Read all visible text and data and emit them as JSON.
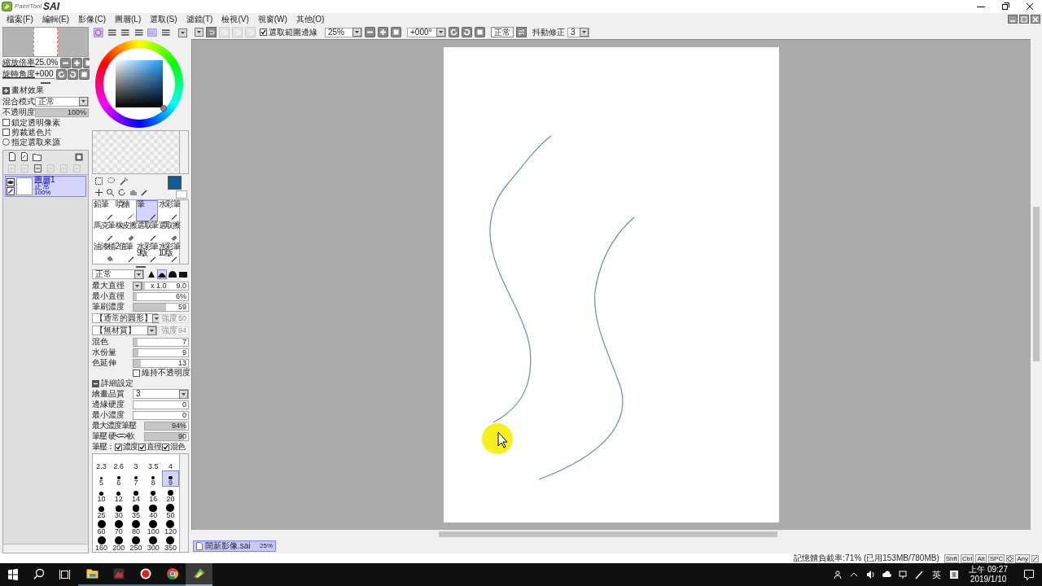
{
  "app": {
    "logo_small": "PaintTool",
    "logo_big": "SAI"
  },
  "menu": [
    "檔案(F)",
    "編輯(E)",
    "影像(C)",
    "圖層(L)",
    "選取(S)",
    "濾鏡(T)",
    "檢視(V)",
    "視窗(W)",
    "其他(O)"
  ],
  "toolbar": {
    "selection_edge": {
      "label": "選取範圍邊緣",
      "checked": true
    },
    "zoom": "25%",
    "rotation": "+000°",
    "blend": "正常",
    "stabilizer": {
      "label": "抖動修正",
      "value": "3"
    }
  },
  "navigator": {
    "zoom": {
      "label": "縮放倍率",
      "value": "25.0%"
    },
    "rotation": {
      "label": "旋轉角度",
      "value": "+000"
    }
  },
  "layer_panel": {
    "texture_toggle": {
      "label": "畫材效果",
      "expanded": false
    },
    "blend": {
      "label": "混合模式",
      "value": "正常"
    },
    "opacity": {
      "label": "不透明度",
      "value": "100%",
      "level": 1
    },
    "options": [
      {
        "kind": "checkbox",
        "label": "鎖定透明像素",
        "checked": false
      },
      {
        "kind": "checkbox",
        "label": "剪裁遮色片",
        "checked": false
      },
      {
        "kind": "radio",
        "label": "指定選取來源",
        "checked": false
      }
    ],
    "layers": [
      {
        "name": "圖層1",
        "mode": "正常",
        "opacity": "100%",
        "selected": true
      }
    ]
  },
  "tools": [
    {
      "label": "鉛筆",
      "kind": "pen",
      "selected": false
    },
    {
      "label": "噴槍",
      "kind": "airbrush",
      "selected": false
    },
    {
      "label": "筆",
      "kind": "pen",
      "selected": true
    },
    {
      "label": "水彩筆",
      "kind": "pen",
      "selected": false
    },
    {
      "label": "馬克筆",
      "kind": "pen",
      "selected": false
    },
    {
      "label": "橡皮擦",
      "kind": "eraser",
      "selected": false
    },
    {
      "label": "選取筆",
      "kind": "pen",
      "selected": false
    },
    {
      "label": "選取擦",
      "kind": "eraser",
      "selected": false
    },
    {
      "label": "油漆桶",
      "kind": "bucket",
      "selected": false
    },
    {
      "label": "2值筆",
      "kind": "pen",
      "selected": false
    },
    {
      "label": "水彩筆 9版",
      "kind": "pen",
      "selected": false
    },
    {
      "label": "水彩筆 10版",
      "kind": "pen",
      "selected": false
    }
  ],
  "brush": {
    "mode": "正常",
    "shapes": [
      {
        "selected": false
      },
      {
        "selected": true
      },
      {
        "selected": false
      },
      {
        "selected": false
      }
    ],
    "sliders": [
      {
        "label": "最大直徑",
        "prefix": "x 1.0",
        "value": "9.0",
        "level": 0.05
      },
      {
        "label": "最小直徑",
        "value": "6%",
        "level": 0.06
      },
      {
        "label": "筆刷濃度",
        "value": "59",
        "level": 0.59
      }
    ],
    "textures": [
      {
        "label": "【通常的圓形】",
        "strength_label": "強度",
        "strength": "50",
        "disabled": true
      },
      {
        "label": "【無材質】",
        "strength_label": "強度",
        "strength": "94",
        "disabled": true
      }
    ],
    "mix_sliders": [
      {
        "label": "混色",
        "value": "7",
        "level": 0.07
      },
      {
        "label": "水份量",
        "value": "9",
        "level": 0.09
      },
      {
        "label": "色延伸",
        "value": "13",
        "level": 0.13
      }
    ],
    "keep_opacity": {
      "label": "維持不透明度",
      "checked": false
    }
  },
  "advanced": {
    "title": "詳細設定",
    "expanded": true,
    "quality": {
      "label": "繪畫品質",
      "value": "3"
    },
    "sliders": [
      {
        "label": "邊緣硬度",
        "value": "0",
        "level": 0
      },
      {
        "label": "最小濃度",
        "value": "0",
        "level": 0
      },
      {
        "label": "最大濃度筆壓",
        "value": "94%",
        "level": 0.94
      },
      {
        "label": "筆壓 硬<=>軟",
        "value": "90",
        "level": 0.9
      }
    ],
    "pressure": {
      "label": "筆壓：",
      "options": [
        {
          "label": "濃度",
          "checked": true
        },
        {
          "label": "直徑",
          "checked": true
        },
        {
          "label": "混色",
          "checked": true
        }
      ]
    }
  },
  "brush_sizes": [
    {
      "label": "2.3",
      "selected": false
    },
    {
      "label": "2.6",
      "selected": false
    },
    {
      "label": "3",
      "selected": false
    },
    {
      "label": "3.5",
      "selected": false
    },
    {
      "label": "4",
      "selected": false
    },
    {
      "label": "5",
      "selected": false
    },
    {
      "label": "6",
      "selected": false
    },
    {
      "label": "7",
      "selected": false
    },
    {
      "label": "8",
      "selected": false
    },
    {
      "label": "9",
      "selected": true
    },
    {
      "label": "10",
      "selected": false
    },
    {
      "label": "12",
      "selected": false
    },
    {
      "label": "14",
      "selected": false
    },
    {
      "label": "16",
      "selected": false
    },
    {
      "label": "20",
      "selected": false
    },
    {
      "label": "25",
      "selected": false
    },
    {
      "label": "30",
      "selected": false
    },
    {
      "label": "35",
      "selected": false
    },
    {
      "label": "40",
      "selected": false
    },
    {
      "label": "50",
      "selected": false
    },
    {
      "label": "60",
      "selected": false
    },
    {
      "label": "70",
      "selected": false
    },
    {
      "label": "80",
      "selected": false
    },
    {
      "label": "100",
      "selected": false
    },
    {
      "label": "120",
      "selected": false
    },
    {
      "label": "160",
      "selected": false
    },
    {
      "label": "200",
      "selected": false
    },
    {
      "label": "250",
      "selected": false
    },
    {
      "label": "300",
      "selected": false
    },
    {
      "label": "350",
      "selected": false
    }
  ],
  "document_tabs": [
    {
      "name": "開新影像.sai",
      "zoom": "25%",
      "selected": true
    }
  ],
  "status": {
    "memory": "記憶體負載率:71% (已用153MB/780MB)",
    "keys": [
      "Shft",
      "Ctrl",
      "Alt",
      "SPC"
    ],
    "any_key": "Any"
  },
  "taskbar": {
    "apps": [
      {
        "kind": "folder",
        "active": false
      },
      {
        "kind": "video",
        "active": false
      },
      {
        "kind": "record",
        "active": false
      },
      {
        "kind": "browser",
        "active": false
      },
      {
        "kind": "paint",
        "active": true
      }
    ],
    "ime": "英",
    "time": "上午 09:27",
    "date": "2019/1/10"
  }
}
